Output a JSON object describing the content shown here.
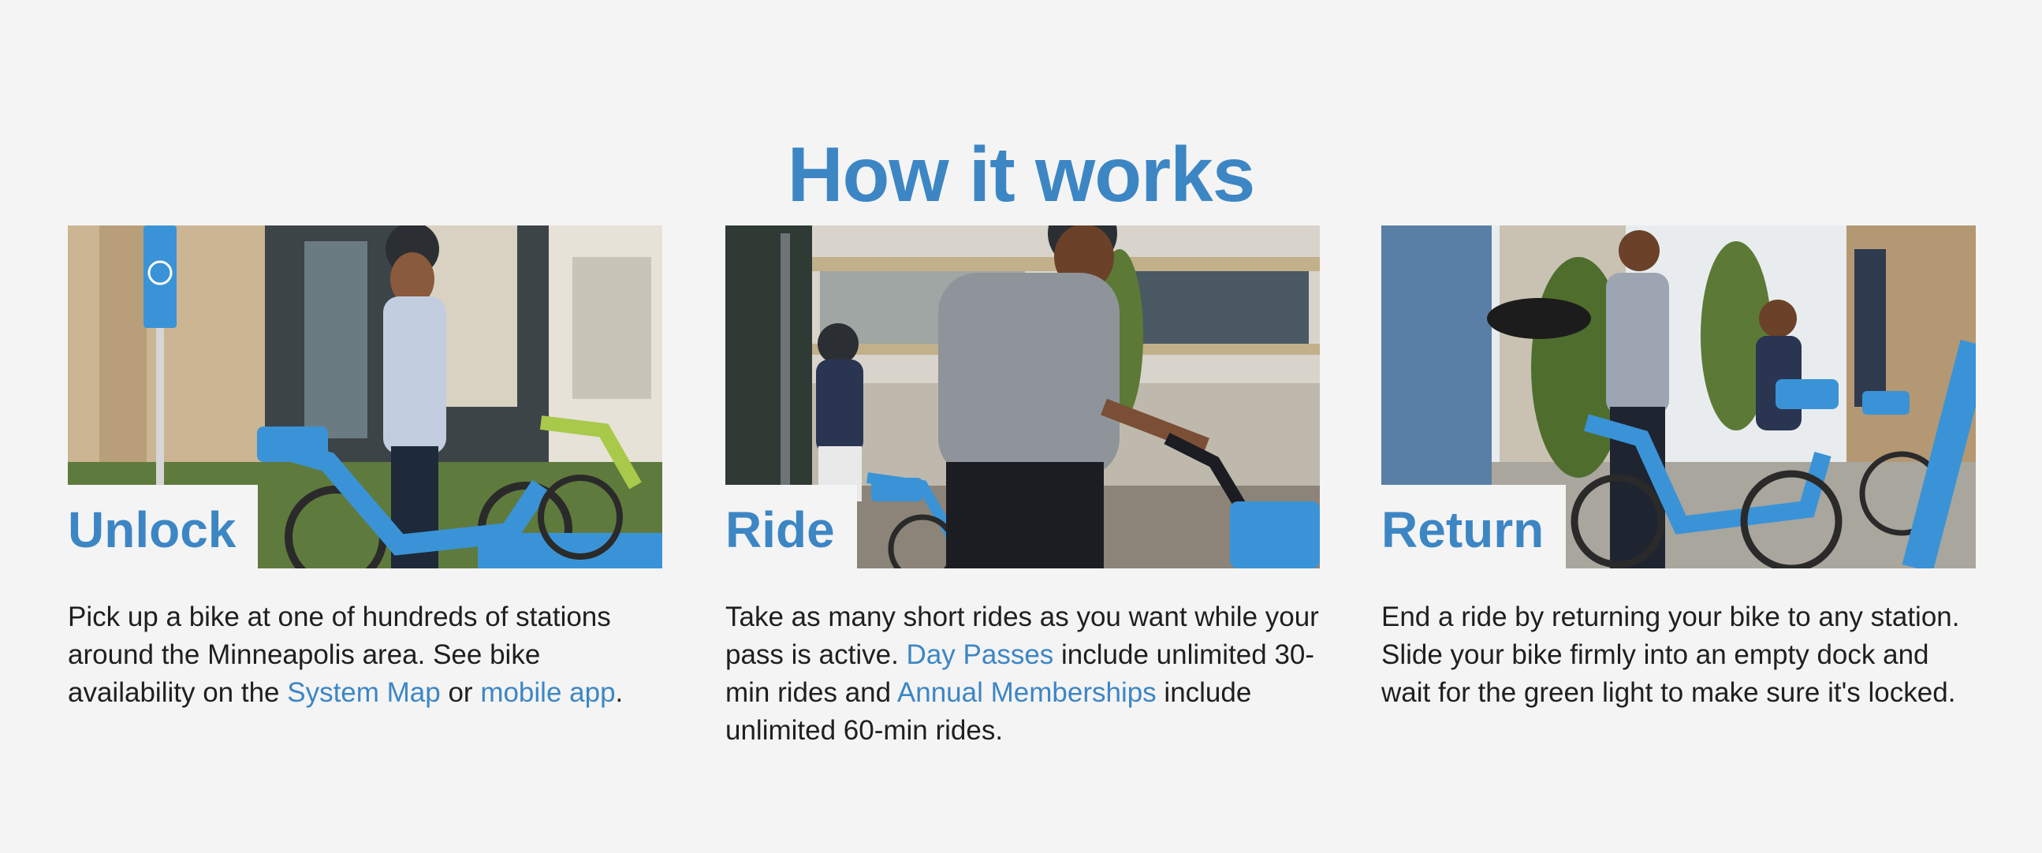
{
  "section": {
    "heading": "How it works"
  },
  "cards": [
    {
      "title": "Unlock",
      "text_1": "Pick up a bike at one of hundreds of stations around the Minneapolis area. See bike availability on the ",
      "link_1": "System Map",
      "text_2": " or ",
      "link_2": "mobile app",
      "text_3": "."
    },
    {
      "title": "Ride",
      "text_1": "Take as many short rides as you want while your pass is active. ",
      "link_1": "Day Passes",
      "text_2": " include unlimited 30-min rides and ",
      "link_2": "Annual Memberships",
      "text_3": " include unlimited 60-min rides."
    },
    {
      "title": "Return",
      "text_1": "End a ride by returning your bike to any station. Slide your bike firmly into an empty dock and wait for the green light to make sure it's locked."
    }
  ],
  "colors": {
    "accent": "#3d86c4",
    "background": "#f4f4f4",
    "text": "#1f1f1f",
    "bike_blue": "#3a93d6"
  }
}
